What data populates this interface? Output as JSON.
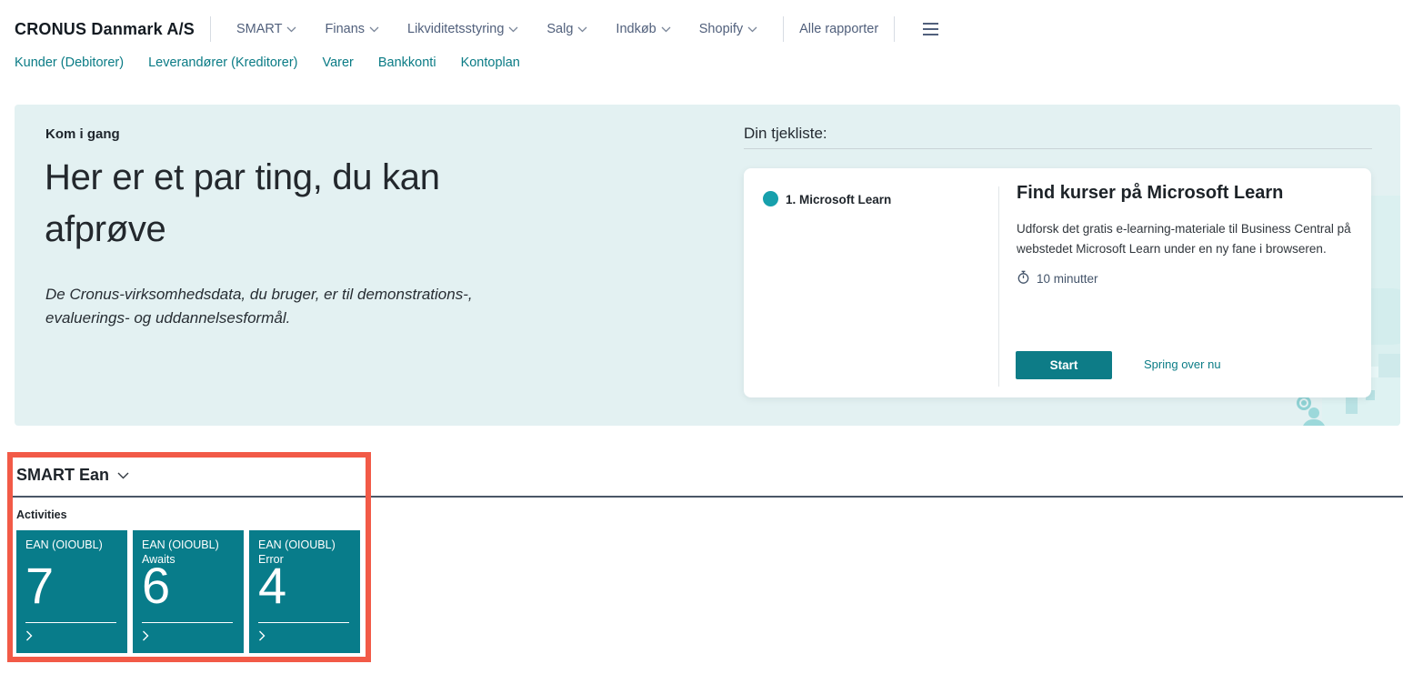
{
  "app": {
    "company_name": "CRONUS Danmark A/S",
    "nav": {
      "menus": [
        "SMART",
        "Finans",
        "Likviditetsstyring",
        "Salg",
        "Indkøb",
        "Shopify"
      ],
      "all_reports_label": "Alle rapporter"
    },
    "subnav": [
      "Kunder (Debitorer)",
      "Leverandører (Kreditorer)",
      "Varer",
      "Bankkonti",
      "Kontoplan"
    ]
  },
  "hero": {
    "eyebrow": "Kom i gang",
    "title": "Her er et par ting, du kan afprøve",
    "subtitle": "De Cronus-virksomhedsdata, du bruger, er til demonstrations-, evaluerings- og uddannelsesformål."
  },
  "checklist": {
    "header": "Din tjekliste:",
    "item_label": "1. Microsoft Learn",
    "card": {
      "title": "Find kurser på Microsoft Learn",
      "description": "Udforsk det gratis e-learning-materiale til Business Central på webstedet Microsoft Learn under en ny fane i browseren.",
      "duration": "10 minutter",
      "start_label": "Start",
      "skip_label": "Spring over nu"
    }
  },
  "smart_ean": {
    "title": "SMART Ean",
    "section_label": "Activities",
    "tiles": [
      {
        "label": "EAN (OIOUBL)",
        "sublabel": "",
        "value": "7"
      },
      {
        "label": "EAN (OIOUBL)",
        "sublabel": "Awaits",
        "value": "6"
      },
      {
        "label": "EAN (OIOUBL)",
        "sublabel": "Error",
        "value": "4"
      }
    ]
  },
  "colors": {
    "tile_teal": "#087c8a",
    "button_teal": "#0d7c87",
    "link_teal": "#0a7b85",
    "checklist_dot_teal": "#17a0ac",
    "hero_background": "#e3f1f2",
    "highlight_red": "#f25a47",
    "nav_text": "#51607c",
    "dark_rule": "#4a5666"
  }
}
